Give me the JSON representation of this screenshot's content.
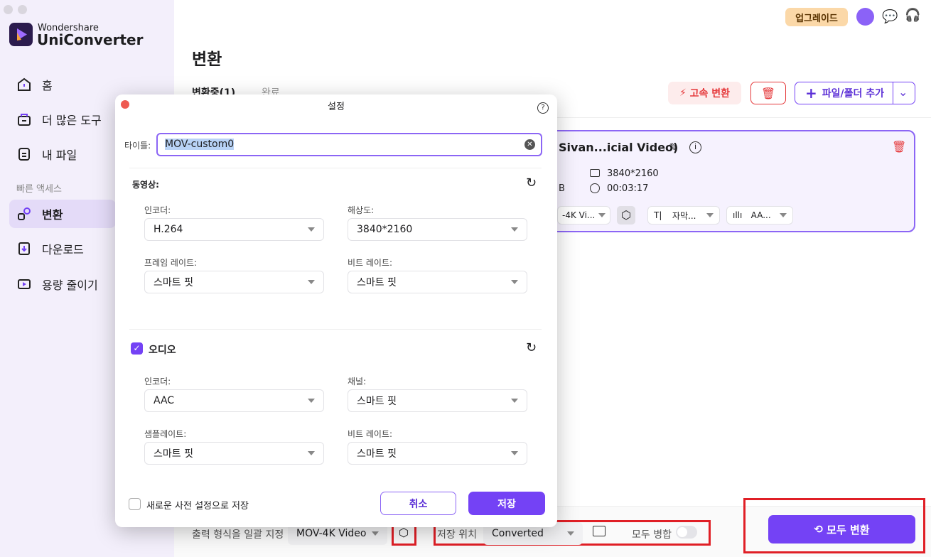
{
  "app": {
    "brand_top": "Wondershare",
    "brand_bottom": "UniConverter"
  },
  "sidebar": {
    "items": [
      {
        "label": "홈",
        "icon": "home-icon"
      },
      {
        "label": "더 많은 도구",
        "icon": "toolbox-icon"
      },
      {
        "label": "내 파일",
        "icon": "file-icon"
      }
    ],
    "section": "빠른 액세스",
    "quick": [
      {
        "label": "변환",
        "icon": "convert-icon",
        "active": true
      },
      {
        "label": "다운로드",
        "icon": "download-icon"
      },
      {
        "label": "용량 줄이기",
        "icon": "compress-icon"
      }
    ]
  },
  "header": {
    "upgrade": "업그레이드"
  },
  "main": {
    "title": "변환",
    "tabs": [
      "변환중(1)",
      "완료"
    ],
    "fast_convert": "고속 변환",
    "add_files": "파일/폴더 추가",
    "file": {
      "name": "Sivan...icial Video)",
      "size_suffix": "B",
      "resolution": "3840*2160",
      "duration": "00:03:17",
      "format": "-4K Vi...",
      "subtitle": "자막...",
      "audio": "AA..."
    }
  },
  "bottom": {
    "output_label": "출력 형식을 일괄 지정",
    "output_value": "MOV-4K Video",
    "save_label": "저장 위치",
    "save_value": "Converted",
    "merge_label": "모두 병합",
    "merge_on": false,
    "convert_all": "모두 변환"
  },
  "dialog": {
    "title": "설정",
    "title_label": "타이틀:",
    "title_value": "MOV-custom0",
    "video": {
      "section": "동영상:",
      "encoder_label": "인코더:",
      "encoder": "H.264",
      "resolution_label": "해상도:",
      "resolution": "3840*2160",
      "framerate_label": "프레임 레이트:",
      "framerate": "스마트 핏",
      "bitrate_label": "비트 레이트:",
      "bitrate": "스마트 핏"
    },
    "audio": {
      "section": "오디오",
      "checked": true,
      "encoder_label": "인코더:",
      "encoder": "AAC",
      "channel_label": "채널:",
      "channel": "스마트 핏",
      "samplerate_label": "샘플레이트:",
      "samplerate": "스마트 핏",
      "bitrate_label": "비트 레이트:",
      "bitrate": "스마트 핏"
    },
    "save_preset": "새로운 사전 설정으로 저장",
    "cancel": "취소",
    "save": "저장"
  },
  "colors": {
    "accent": "#7442f5",
    "danger": "#e5393b",
    "highlight": "#e01f26"
  }
}
